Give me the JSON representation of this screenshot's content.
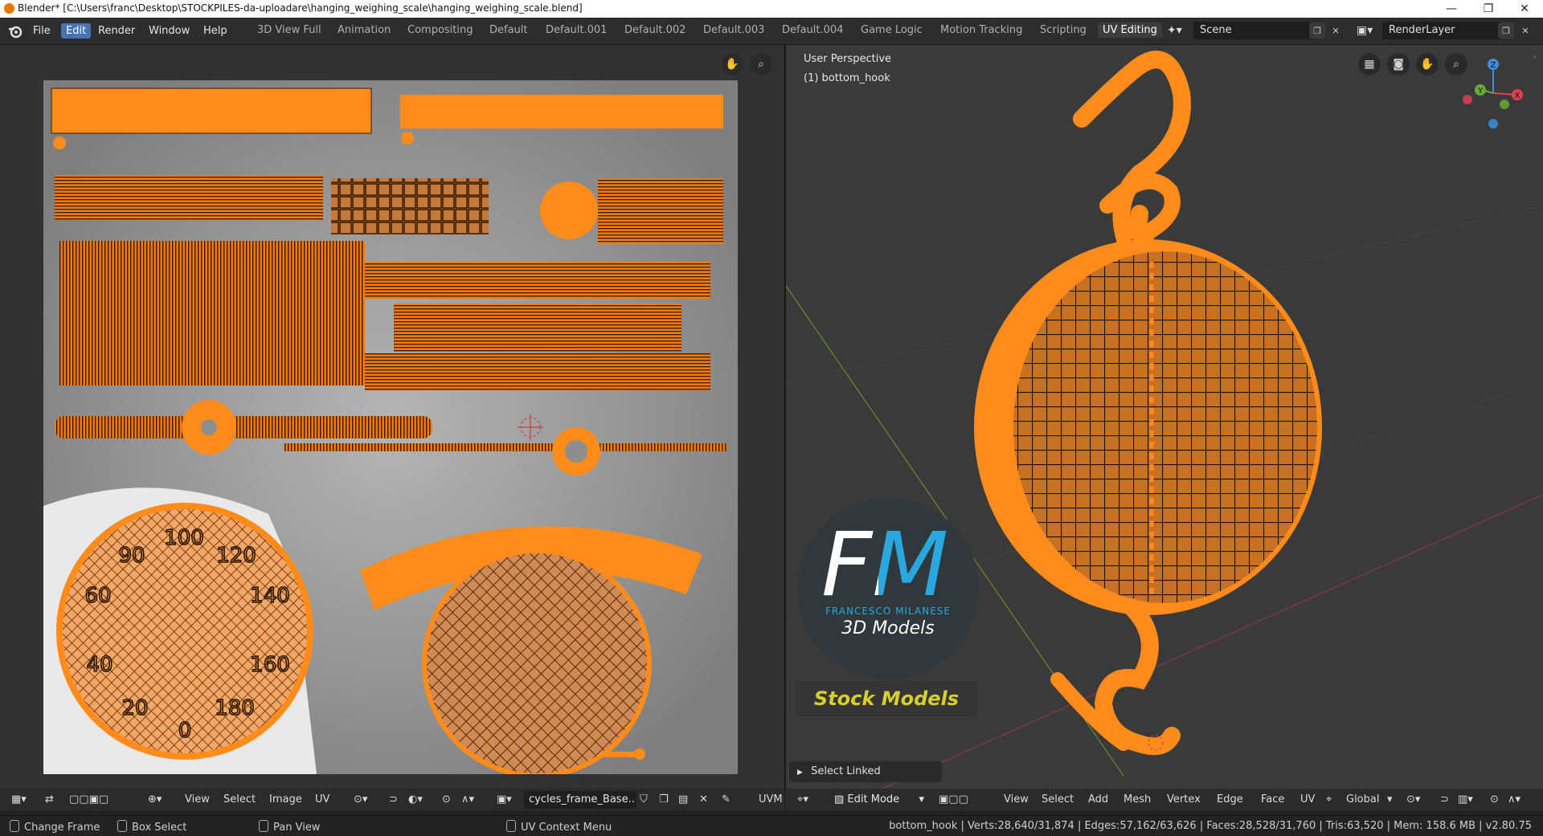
{
  "window": {
    "title": "Blender* [C:\\Users\\franc\\Desktop\\STOCKPILES-da-uploadare\\hanging_weighing_scale\\hanging_weighing_scale.blend]",
    "minimize": "—",
    "maximize": "❐",
    "close": "✕"
  },
  "menu": [
    "File",
    "Edit",
    "Render",
    "Window",
    "Help"
  ],
  "active_menu": "Edit",
  "workspace_tabs": [
    "3D View Full",
    "Animation",
    "Compositing",
    "Default",
    "Default.001",
    "Default.002",
    "Default.003",
    "Default.004",
    "Game Logic",
    "Motion Tracking",
    "Scripting",
    "UV Editing"
  ],
  "active_tab": "UV Editing",
  "scene": "Scene",
  "render_layer": "RenderLayer",
  "uv_editor": {
    "menus": [
      "View",
      "Select",
      "Image",
      "UV"
    ],
    "image_name": "cycles_frame_Base..",
    "uvmap_label": "UVM",
    "dial_numbers": [
      "100",
      "90",
      "120",
      "60",
      "140",
      "40",
      "160",
      "20",
      "180",
      "0"
    ]
  },
  "viewport": {
    "perspective": "User Perspective",
    "object": "(1) bottom_hook",
    "mode": "Edit Mode",
    "menus": [
      "View",
      "Select",
      "Add",
      "Mesh",
      "Vertex",
      "Edge",
      "Face",
      "UV"
    ],
    "orientation": "Global",
    "operator_panel": "Select Linked",
    "gizmo_labels": [
      "Z",
      "Y",
      "X"
    ]
  },
  "watermark": {
    "logo": "FM",
    "name": "FRANCESCO MILANESE",
    "subtitle": "3D Models",
    "badge": "Stock Models"
  },
  "status": {
    "change_frame": "Change Frame",
    "box_select": "Box Select",
    "pan_view": "Pan View",
    "uv_context_menu": "UV Context Menu",
    "stats": "bottom_hook | Verts:28,640/31,874 | Edges:57,162/63,626 | Faces:28,528/31,760 | Tris:63,520 | Mem: 158.6 MB | v2.80.75"
  },
  "colors": {
    "accent": "#ff8c1a",
    "uv_bg": "#8e8e8e",
    "active_menu": "#4772b3",
    "viewport_bg": "#3a3a3a"
  }
}
